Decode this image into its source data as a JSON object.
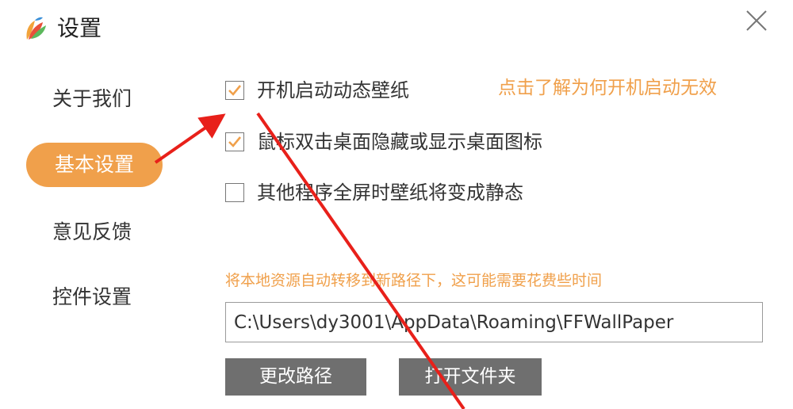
{
  "window": {
    "title": "设置"
  },
  "sidebar": {
    "items": [
      {
        "label": "关于我们",
        "active": false
      },
      {
        "label": "基本设置",
        "active": true
      },
      {
        "label": "意见反馈",
        "active": false
      },
      {
        "label": "控件设置",
        "active": false
      }
    ]
  },
  "options": [
    {
      "label": "开机启动动态壁纸",
      "checked": true
    },
    {
      "label": "鼠标双击桌面隐藏或显示桌面图标",
      "checked": true
    },
    {
      "label": "其他程序全屏时壁纸将变成静态",
      "checked": false
    }
  ],
  "help_link": "点击了解为何开机启动无效",
  "storage": {
    "hint": "将本地资源自动转移到新路径下，这可能需要花费些时间",
    "path_value": "C:\\Users\\dy3001\\AppData\\Roaming\\FFWallPaper"
  },
  "buttons": {
    "change_path": "更改路径",
    "open_folder": "打开文件夹"
  },
  "colors": {
    "accent": "#f0a04b",
    "button": "#6f6f6f",
    "annotation_arrow": "#e8201a"
  },
  "icons": {
    "logo": "leaf-logo-icon",
    "close": "close-icon",
    "check": "check-icon"
  }
}
